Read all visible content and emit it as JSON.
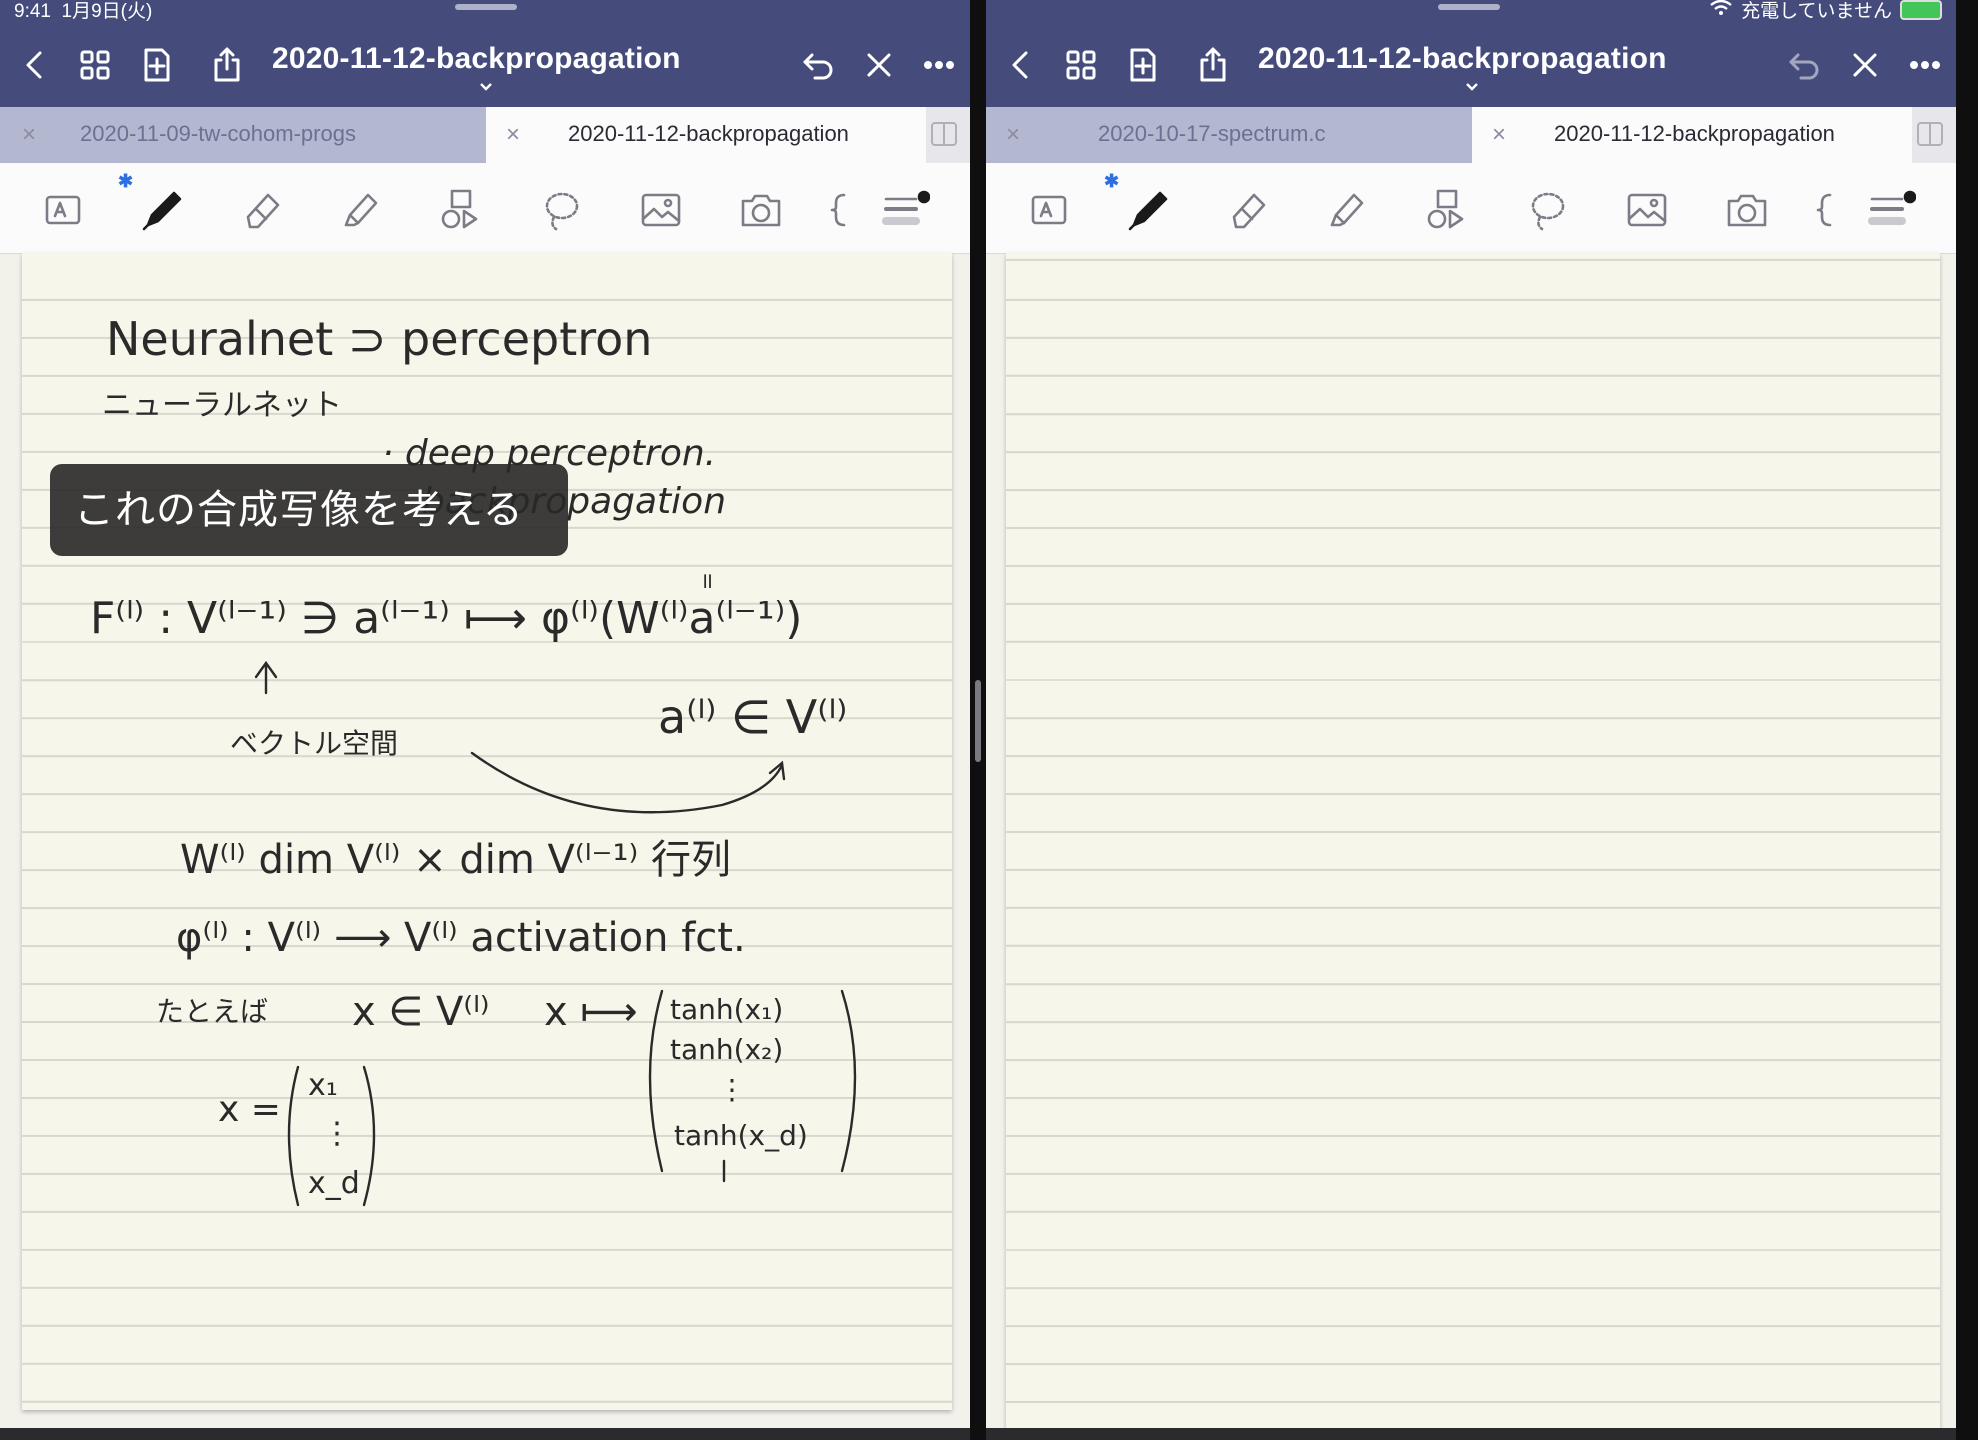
{
  "status": {
    "time": "9:41",
    "date": "1月9日(火)",
    "charging": "充電していません"
  },
  "left_pane": {
    "title": "2020-11-12-backpropagation",
    "tabs": [
      {
        "label": "2020-11-09-tw-cohom-progs",
        "active": false
      },
      {
        "label": "2020-11-12-backpropagation",
        "active": true
      }
    ],
    "note": {
      "line1": "Neuralnet ⊃ perceptron",
      "line2": "ニューラルネット",
      "line3": "· deep perceptron.",
      "line4": "backpropagation",
      "eq1": "F⁽ˡ⁾ :  V⁽ˡ⁻¹⁾ ∋ a⁽ˡ⁻¹⁾ ⟼ φ⁽ˡ⁾(W⁽ˡ⁾a⁽ˡ⁻¹⁾)",
      "eq1_ann": "ベクトル空間",
      "eq2": "a⁽ˡ⁾ ∈ V⁽ˡ⁾",
      "eq3": "W⁽ˡ⁾   dim V⁽ˡ⁾ × dim V⁽ˡ⁻¹⁾  行列",
      "eq4": "φ⁽ˡ⁾ : V⁽ˡ⁾ ⟶ V⁽ˡ⁾     activation fct.",
      "eq5a": "たとえば",
      "eq5b": "x ∈ V⁽ˡ⁾",
      "eq5c": "x ⟼",
      "mat_right": [
        "tanh(x₁)",
        "tanh(x₂)",
        "⋮",
        "tanh(x_d)"
      ],
      "mat_left_label": "x =",
      "mat_left": [
        "x₁",
        "⋮",
        "x_d"
      ]
    },
    "caption": "これの合成写像を考える"
  },
  "right_pane": {
    "title": "2020-11-12-backpropagation",
    "tabs": [
      {
        "label": "2020-10-17-spectrum.c",
        "active": false
      },
      {
        "label": "2020-11-12-backpropagation",
        "active": true
      }
    ]
  },
  "icons": {
    "nav": [
      "back-icon",
      "grid-icon",
      "new-page-icon",
      "share-icon",
      "undo-icon",
      "redo-icon",
      "more-icon"
    ],
    "tools": [
      "text-tool-icon",
      "pen-tool-icon",
      "eraser-tool-icon",
      "highlighter-tool-icon",
      "shapes-tool-icon",
      "lasso-tool-icon",
      "image-tool-icon",
      "camera-tool-icon",
      "bracket-tool-icon",
      "pen-settings-icon"
    ]
  },
  "colors": {
    "navbar": "#454c7c",
    "inactive_tab": "#b3b7cf",
    "paper": "#f7f6ea",
    "bluetooth": "#2b6fe0",
    "battery": "#43c659"
  }
}
